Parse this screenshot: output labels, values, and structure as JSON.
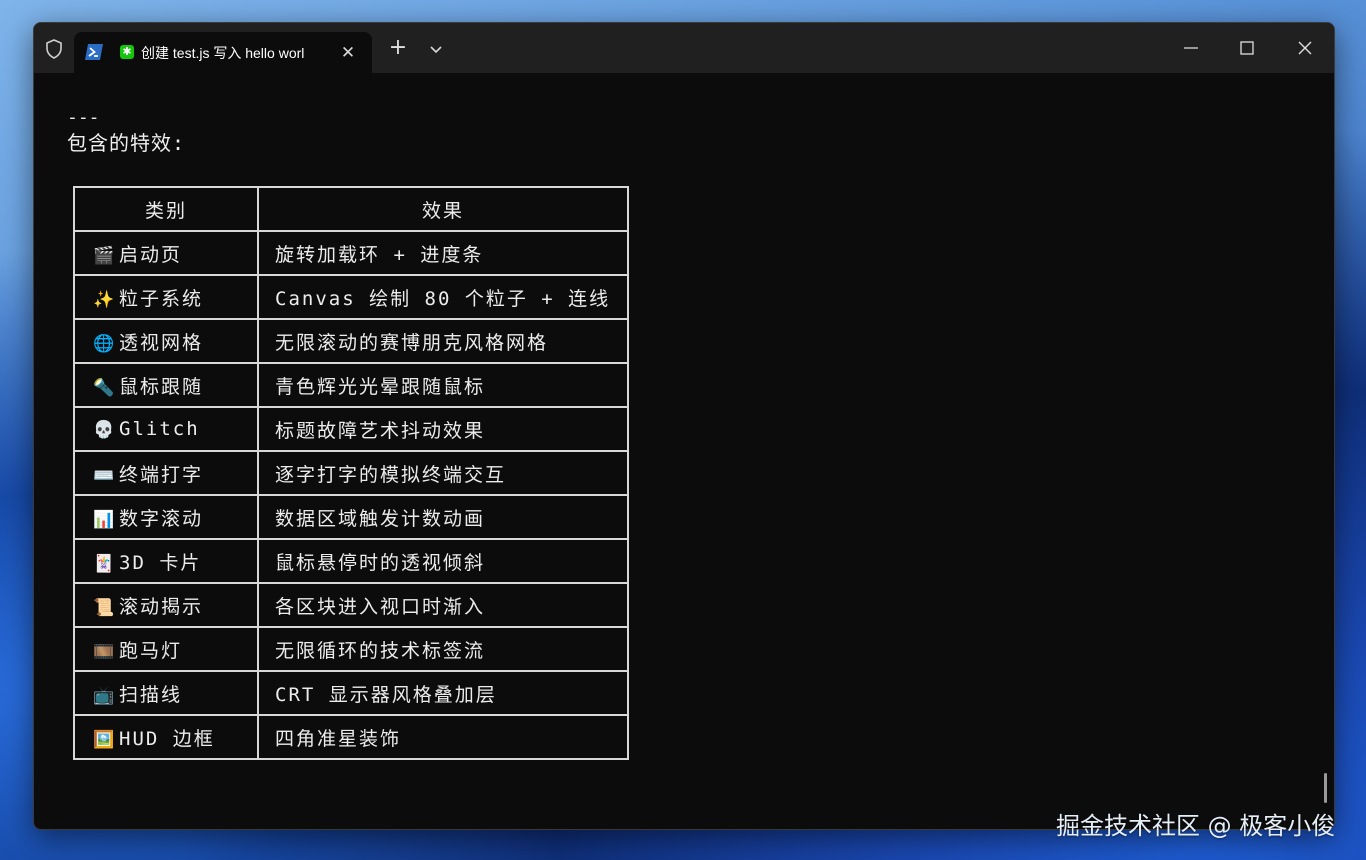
{
  "titlebar": {
    "tab_title": "创建 test.js 写入 hello worl",
    "tab_close": "✕",
    "new_tab": "+"
  },
  "terminal": {
    "dashes": "---",
    "heading": "包含的特效:",
    "table": {
      "headers": [
        "类别",
        "效果"
      ],
      "rows": [
        {
          "icon": "🎬",
          "icon_name": "clapper-icon",
          "category": "启动页",
          "effect": "旋转加载环 + 进度条"
        },
        {
          "icon": "✨",
          "icon_name": "sparkles-icon",
          "category": "粒子系统",
          "effect": "Canvas 绘制 80 个粒子 + 连线"
        },
        {
          "icon": "🌐",
          "icon_name": "globe-icon",
          "category": "透视网格",
          "effect": "无限滚动的赛博朋克风格网格"
        },
        {
          "icon": "🔦",
          "icon_name": "flashlight-icon",
          "category": "鼠标跟随",
          "effect": "青色辉光光晕跟随鼠标"
        },
        {
          "icon": "💀",
          "icon_name": "skull-icon",
          "category": "Glitch",
          "effect": "标题故障艺术抖动效果"
        },
        {
          "icon": "⌨️",
          "icon_name": "keyboard-icon",
          "category": "终端打字",
          "effect": "逐字打字的模拟终端交互"
        },
        {
          "icon": "📊",
          "icon_name": "bar-chart-icon",
          "category": "数字滚动",
          "effect": "数据区域触发计数动画"
        },
        {
          "icon": "🃏",
          "icon_name": "playing-card-icon",
          "category": "3D 卡片",
          "effect": "鼠标悬停时的透视倾斜"
        },
        {
          "icon": "📜",
          "icon_name": "scroll-icon",
          "category": "滚动揭示",
          "effect": "各区块进入视口时渐入"
        },
        {
          "icon": "🎞️",
          "icon_name": "film-frames-icon",
          "category": "跑马灯",
          "effect": "无限循环的技术标签流"
        },
        {
          "icon": "📺",
          "icon_name": "television-icon",
          "category": "扫描线",
          "effect": "CRT 显示器风格叠加层"
        },
        {
          "icon": "🖼️",
          "icon_name": "framed-picture-icon",
          "category": "HUD 边框",
          "effect": "四角准星装饰"
        }
      ]
    }
  },
  "watermark": "掘金技术社区 @ 极客小俊",
  "colors": {
    "terminal_bg": "#0c0c0c",
    "titlebar_bg": "#202020",
    "text": "#e8e8e8",
    "tab_badge": "#16c60c"
  }
}
